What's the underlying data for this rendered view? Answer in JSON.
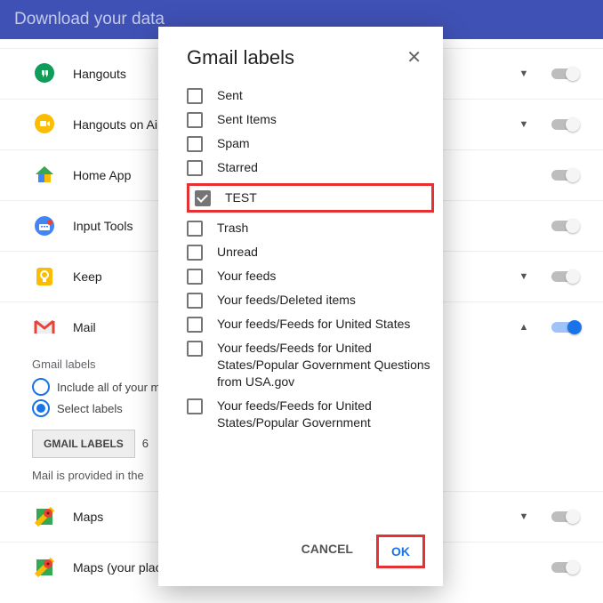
{
  "header": {
    "title": "Download your data"
  },
  "rows": [
    {
      "id": "hangouts",
      "name": "Hangouts",
      "chevron": true,
      "toggle": "off"
    },
    {
      "id": "hangouts-on-air",
      "name": "Hangouts on Air",
      "chevron": true,
      "toggle": "off"
    },
    {
      "id": "home-app",
      "name": "Home App",
      "chevron": false,
      "toggle": "off"
    },
    {
      "id": "input-tools",
      "name": "Input Tools",
      "chevron": false,
      "toggle": "off"
    },
    {
      "id": "keep",
      "name": "Keep",
      "chevron": true,
      "toggle": "off"
    },
    {
      "id": "mail",
      "name": "Mail",
      "chevron": true,
      "toggle": "on",
      "expanded": true
    },
    {
      "id": "maps",
      "name": "Maps",
      "chevron": true,
      "toggle": "off"
    },
    {
      "id": "maps-your-places",
      "name": "Maps (your places)",
      "chevron": false,
      "toggle": "off"
    }
  ],
  "mailSub": {
    "title": "Gmail labels",
    "radio1": "Include all of your mail",
    "radio2": "Select labels",
    "button": "GMAIL LABELS",
    "count": "6",
    "note": "Mail is provided in the"
  },
  "dialog": {
    "title": "Gmail labels",
    "items": [
      {
        "label": "Sent",
        "checked": false
      },
      {
        "label": "Sent Items",
        "checked": false
      },
      {
        "label": "Spam",
        "checked": false
      },
      {
        "label": "Starred",
        "checked": false
      },
      {
        "label": "TEST",
        "checked": true,
        "highlight": true
      },
      {
        "label": "Trash",
        "checked": false
      },
      {
        "label": "Unread",
        "checked": false
      },
      {
        "label": "Your feeds",
        "checked": false
      },
      {
        "label": "Your feeds/Deleted items",
        "checked": false
      },
      {
        "label": "Your feeds/Feeds for United States",
        "checked": false
      },
      {
        "label": "Your feeds/Feeds for United States/Popular Government Questions from USA.gov",
        "checked": false
      },
      {
        "label": "Your feeds/Feeds for United States/Popular Government",
        "checked": false
      }
    ],
    "cancel": "CANCEL",
    "ok": "OK"
  }
}
